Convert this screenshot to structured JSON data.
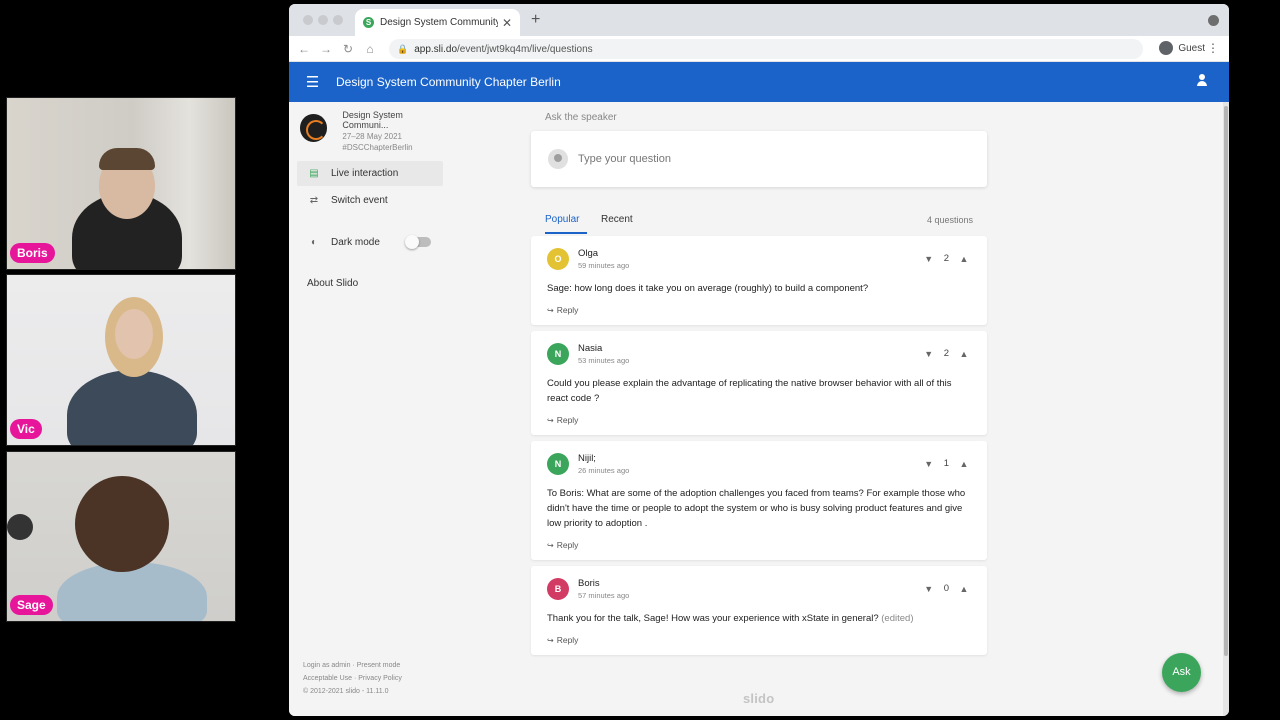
{
  "participants": [
    {
      "name": "Boris"
    },
    {
      "name": "Vic"
    },
    {
      "name": "Sage"
    }
  ],
  "browser": {
    "tab_title": "Design System Community Ch",
    "favicon_letter": "S",
    "url_host": "app.sli.do",
    "url_path": "/event/jwt9kq4m/live/questions",
    "profile_label": "Guest"
  },
  "app": {
    "header_title": "Design System Community Chapter Berlin",
    "event": {
      "name": "Design System Communi...",
      "date": "27–28 May 2021",
      "code": "#DSCChapterBerlin"
    },
    "sidebar": {
      "live_interaction": "Live interaction",
      "switch_event": "Switch event",
      "dark_mode": "Dark mode",
      "about": "About Slido"
    },
    "footer": {
      "line1": "Login as admin · Present mode",
      "line2": "Acceptable Use · Privacy Policy",
      "line3": "© 2012-2021 slido - 11.11.0"
    },
    "ask": {
      "label": "Ask the speaker",
      "placeholder": "Type your question"
    },
    "tabs": {
      "popular": "Popular",
      "recent": "Recent",
      "count": "4 questions"
    },
    "questions": [
      {
        "initial": "O",
        "avatar_color": "#e3c233",
        "author": "Olga",
        "time": "59 minutes ago",
        "votes": "2",
        "text": "Sage: how long does it take you on average (roughly) to build a component?",
        "edited": ""
      },
      {
        "initial": "N",
        "avatar_color": "#3ba65b",
        "author": "Nasia",
        "time": "53 minutes ago",
        "votes": "2",
        "text": "Could you please explain the advantage of replicating the native browser behavior with all of this react code ?",
        "edited": ""
      },
      {
        "initial": "N",
        "avatar_color": "#3ba65b",
        "author": "Nijil;",
        "time": "26 minutes ago",
        "votes": "1",
        "text": "To Boris: What are some of the adoption challenges you faced from teams? For example those who didn't have the time or people to adopt the system or who is busy solving product features and give low priority to adoption .",
        "edited": ""
      },
      {
        "initial": "B",
        "avatar_color": "#d23b63",
        "author": "Boris",
        "time": "57 minutes ago",
        "votes": "0",
        "text": "Thank you for the talk, Sage! How was your experience with xState in general?",
        "edited": "(edited)"
      }
    ],
    "reply_label": "Reply",
    "brand": "slido",
    "ask_button": "Ask"
  }
}
